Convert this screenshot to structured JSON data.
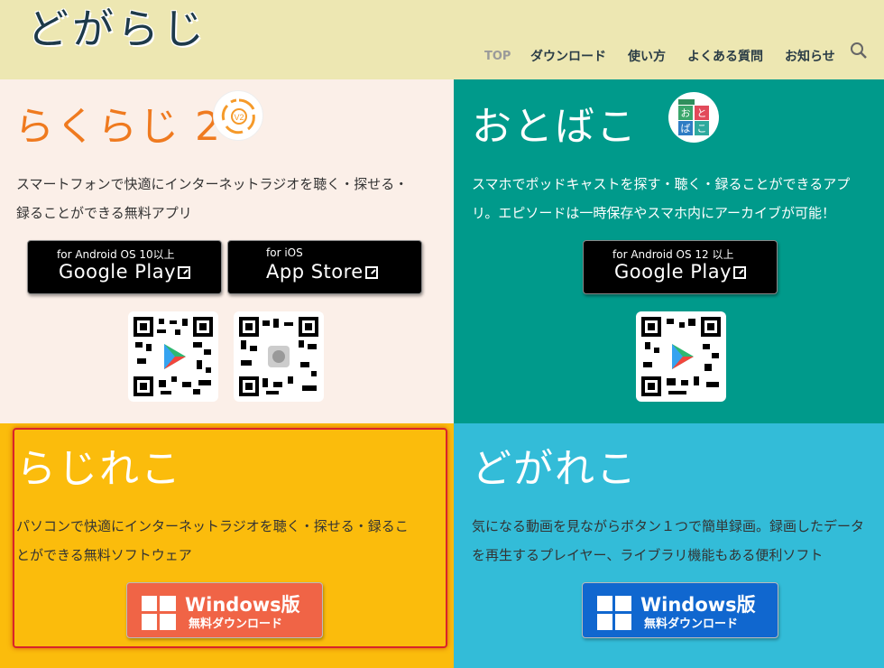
{
  "header": {
    "logo_text": "どがらじ",
    "nav": [
      "TOP",
      "ダウンロード",
      "使い方",
      "よくある質問",
      "お知らせ"
    ]
  },
  "rakuraji": {
    "title": "らくらじ 2",
    "desc_line1": "スマートフォンで快適にインターネットラジオを聴く・探せる・",
    "desc_line2": "録ることができる無料アプリ",
    "android_small": "for Android OS 10以上",
    "android_big": "Google Play",
    "ios_small": "for iOS",
    "ios_big": "App Store",
    "icon_badge": "V2"
  },
  "otobako": {
    "title": "おとばこ",
    "desc_line1": "スマホでポッドキャストを探す・聴く・録ることができるアプ",
    "desc_line2": "リ。エピソードは一時保存やスマホ内にアーカイブが可能！",
    "android_small": "for Android OS 12 以上",
    "android_big": "Google Play",
    "icon_chars": [
      "お",
      "と",
      "ば",
      "こ"
    ]
  },
  "rajireko": {
    "title": "らじれこ",
    "desc_line1": "パソコンで快適にインターネットラジオを聴く・探せる・録るこ",
    "desc_line2": "とができる無料ソフトウェア",
    "btn_main": "Windows版",
    "btn_sub": "無料ダウンロード"
  },
  "dogareko": {
    "title": "どがれこ",
    "desc_line1": "気になる動画を見ながらボタン１つで簡単録画。録画したデータ",
    "desc_line2": "を再生するプレイヤー、ライブラリ機能もある便利ソフト",
    "btn_main": "Windows版",
    "btn_sub": "無料ダウンロード"
  },
  "colors": {
    "header_bg": "#ede7b2",
    "rakuraji_bg": "#fbefe8",
    "otobako_bg": "#009a8b",
    "rajireko_bg": "#fbbc0c",
    "dogareko_bg": "#33bcd8",
    "rajireko_btn": "#f06446",
    "dogareko_btn": "#1067cf",
    "highlight": "#d9232a"
  }
}
